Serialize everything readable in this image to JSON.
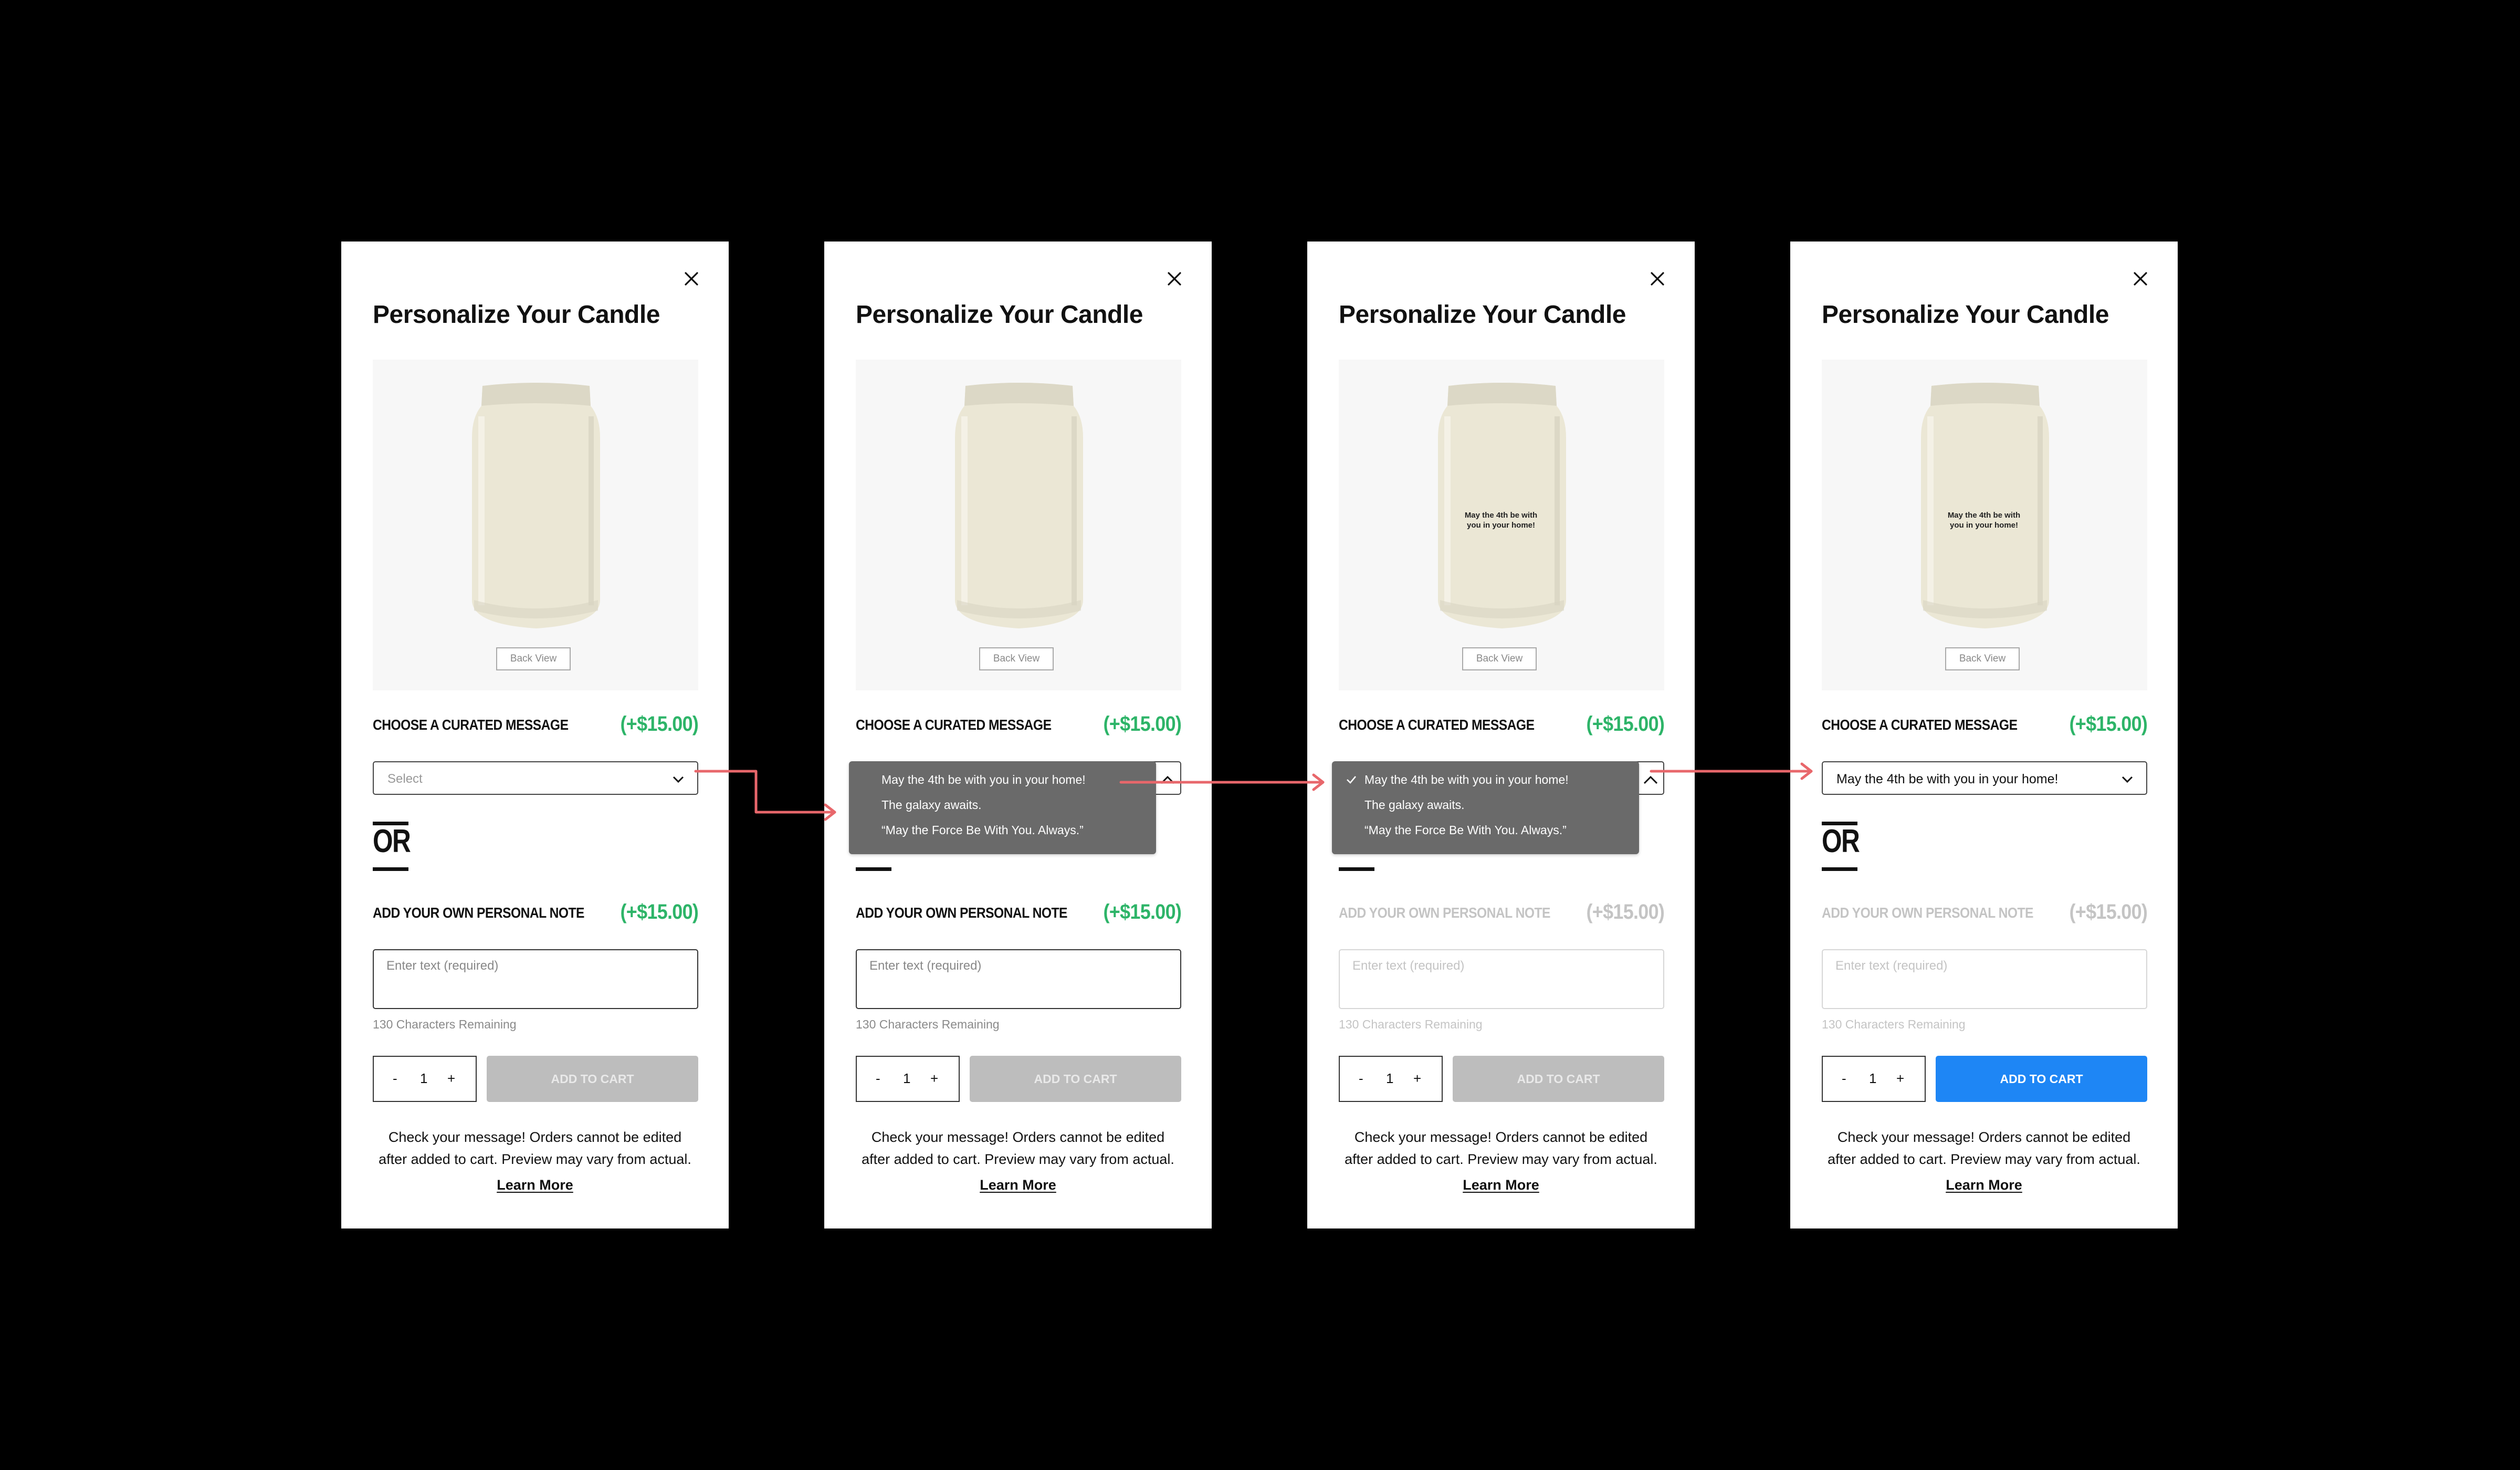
{
  "panels": [
    {
      "title": "Personalize Your Candle",
      "back_view": "Back View",
      "curated_label": "CHOOSE A CURATED MESSAGE",
      "curated_price": "(+$15.00)",
      "select_value": "Select",
      "or_text": "OR",
      "note_label": "ADD YOUR OWN PERSONAL NOTE",
      "note_price": "(+$15.00)",
      "text_placeholder": "Enter text (required)",
      "counter": "130 Characters Remaining",
      "qty_minus": "-",
      "quantity": "1",
      "qty_plus": "+",
      "cart_label": "ADD TO CART",
      "disclaimer_line1": "Check your message! Orders cannot be edited",
      "disclaimer_line2": "after added to cart. Preview may vary from actual.",
      "learn_more": "Learn More"
    },
    {
      "title": "Personalize Your Candle",
      "back_view": "Back View",
      "curated_label": "CHOOSE A CURATED MESSAGE",
      "curated_price": "(+$15.00)",
      "dropdown_options": [
        "May the 4th be with you in your home!",
        "The galaxy awaits.",
        "“May the Force Be With You. Always.”"
      ],
      "or_text": "OR",
      "note_label": "ADD YOUR OWN PERSONAL NOTE",
      "note_price": "(+$15.00)",
      "text_placeholder": "Enter text (required)",
      "counter": "130 Characters Remaining",
      "qty_minus": "-",
      "quantity": "1",
      "qty_plus": "+",
      "cart_label": "ADD TO CART",
      "disclaimer_line1": "Check your message! Orders cannot be edited",
      "disclaimer_line2": "after added to cart. Preview may vary from actual.",
      "learn_more": "Learn More"
    },
    {
      "title": "Personalize Your Candle",
      "candle_text_line1": "May the 4th be with",
      "candle_text_line2": "you in your home!",
      "back_view": "Back View",
      "curated_label": "CHOOSE A CURATED MESSAGE",
      "curated_price": "(+$15.00)",
      "dropdown_options": [
        "May the 4th be with you in your home!",
        "The galaxy awaits.",
        "“May the Force Be With You. Always.”"
      ],
      "selected_option_index": 0,
      "or_text": "OR",
      "note_label": "ADD YOUR OWN PERSONAL NOTE",
      "note_price": "(+$15.00)",
      "text_placeholder": "Enter text (required)",
      "counter": "130 Characters Remaining",
      "qty_minus": "-",
      "quantity": "1",
      "qty_plus": "+",
      "cart_label": "ADD TO CART",
      "disclaimer_line1": "Check your message! Orders cannot be edited",
      "disclaimer_line2": "after added to cart. Preview may vary from actual.",
      "learn_more": "Learn More"
    },
    {
      "title": "Personalize Your Candle",
      "candle_text_line1": "May the 4th be with",
      "candle_text_line2": "you in your home!",
      "back_view": "Back View",
      "curated_label": "CHOOSE A CURATED MESSAGE",
      "curated_price": "(+$15.00)",
      "select_value": "May the 4th be with you in your home!",
      "or_text": "OR",
      "note_label": "ADD YOUR OWN PERSONAL NOTE",
      "note_price": "(+$15.00)",
      "text_placeholder": "Enter text (required)",
      "counter": "130 Characters Remaining",
      "qty_minus": "-",
      "quantity": "1",
      "qty_plus": "+",
      "cart_label": "ADD TO CART",
      "disclaimer_line1": "Check your message! Orders cannot be edited",
      "disclaimer_line2": "after added to cart. Preview may vary from actual.",
      "learn_more": "Learn More"
    }
  ],
  "colors": {
    "background": "#000000",
    "price_green": "#2db468",
    "cart_disabled": "#bdbdbd",
    "cart_active": "#1e86f5",
    "dropdown_bg": "#6a6a6a",
    "flow_arrow": "#e8676b"
  }
}
